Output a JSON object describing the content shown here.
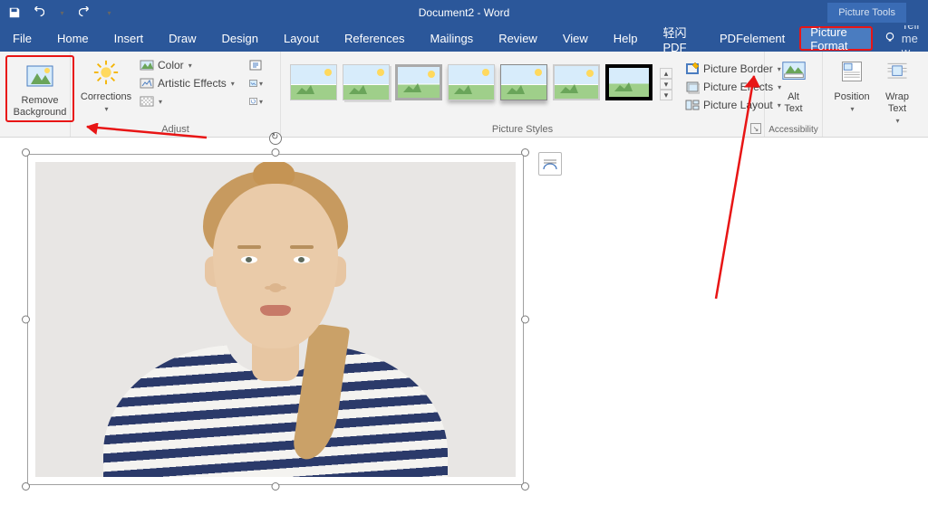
{
  "titlebar": {
    "doc_title": "Document2 - Word",
    "context_tab": "Picture Tools"
  },
  "tabs": {
    "file": "File",
    "home": "Home",
    "insert": "Insert",
    "draw": "Draw",
    "design": "Design",
    "layout": "Layout",
    "references": "References",
    "mailings": "Mailings",
    "review": "Review",
    "view": "View",
    "help": "Help",
    "qspdf": "轻闪PDF",
    "pdfelement": "PDFelement",
    "picture_format": "Picture Format",
    "tell_me": "Tell me w"
  },
  "ribbon": {
    "remove_bg": "Remove\nBackground",
    "corrections": "Corrections",
    "color": "Color",
    "artistic": "Artistic Effects",
    "adjust_label": "Adjust",
    "picture_styles_label": "Picture Styles",
    "picture_border": "Picture Border",
    "picture_effects": "Picture Effects",
    "picture_layout": "Picture Layout",
    "alt_text": "Alt\nText",
    "accessibility_label": "Accessibility",
    "position": "Position",
    "wrap_text": "Wrap\nText"
  }
}
